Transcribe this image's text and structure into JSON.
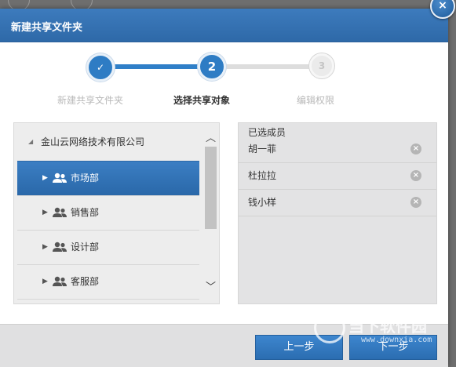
{
  "dialog": {
    "title": "新建共享文件夹",
    "close_symbol": "×"
  },
  "stepper": {
    "steps": [
      {
        "number": "✓",
        "label": "新建共享文件夹",
        "state": "done"
      },
      {
        "number": "2",
        "label": "选择共享对象",
        "state": "active"
      },
      {
        "number": "3",
        "label": "编辑权限",
        "state": "pending"
      }
    ]
  },
  "tree": {
    "root_arrow": "◢",
    "root_label": "金山云网络技术有限公司",
    "caret": "▶",
    "items": [
      {
        "label": "市场部",
        "icon": "group-icon",
        "selected": true
      },
      {
        "label": "销售部",
        "icon": "group-icon",
        "selected": false
      },
      {
        "label": "设计部",
        "icon": "group-icon",
        "selected": false
      },
      {
        "label": "客服部",
        "icon": "group-icon",
        "selected": false
      }
    ],
    "scroll_up": "︿",
    "scroll_down": "﹀"
  },
  "selected_panel": {
    "title": "已选成员",
    "members": [
      "胡一菲",
      "杜拉拉",
      "钱小样"
    ],
    "remove_symbol": "×"
  },
  "footer": {
    "prev_label": "上一步",
    "next_label": "下一步"
  },
  "watermark": {
    "text": "当下软件园",
    "sub": "www.downxia.com"
  },
  "colors": {
    "accent": "#2f6dae",
    "step_active": "#2e7cc4",
    "step_pending": "#d8d8d8"
  }
}
